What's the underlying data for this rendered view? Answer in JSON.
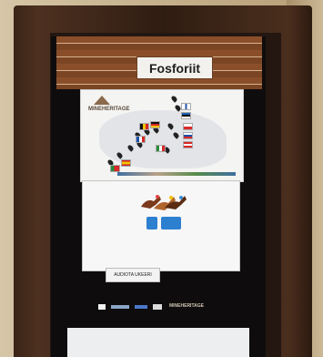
{
  "photo": {
    "title": "Fosforiit",
    "map_logo": "MINEHERITAGE",
    "audio_button": "AUDIOTA UKEERI",
    "footer_logo": "MINEHERITAGE"
  },
  "colors": {
    "frame_wood": "#3a2416",
    "header_wood": "#8a4f2a",
    "button_blue": "#2d7fd0",
    "screen_black": "#0f0c0d"
  }
}
